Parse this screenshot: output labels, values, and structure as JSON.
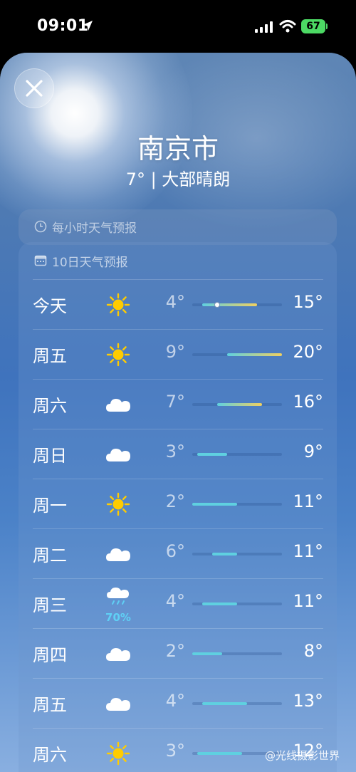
{
  "status_bar": {
    "time": "09:01",
    "battery": "67"
  },
  "header": {
    "city": "南京市",
    "summary": "7° | 大部晴朗"
  },
  "hourly": {
    "label": "每小时天气预报"
  },
  "daily": {
    "label": "10日天气预报",
    "range_min": 2,
    "range_max": 20,
    "days": [
      {
        "day": "今天",
        "icon": "sun-icon",
        "low": "4°",
        "high": "15°",
        "low_v": 4,
        "high_v": 15,
        "current_v": 7,
        "precip": ""
      },
      {
        "day": "周五",
        "icon": "sun-icon",
        "low": "9°",
        "high": "20°",
        "low_v": 9,
        "high_v": 20,
        "precip": ""
      },
      {
        "day": "周六",
        "icon": "cloud-icon",
        "low": "7°",
        "high": "16°",
        "low_v": 7,
        "high_v": 16,
        "precip": ""
      },
      {
        "day": "周日",
        "icon": "cloud-icon",
        "low": "3°",
        "high": "9°",
        "low_v": 3,
        "high_v": 9,
        "precip": ""
      },
      {
        "day": "周一",
        "icon": "sun-icon",
        "low": "2°",
        "high": "11°",
        "low_v": 2,
        "high_v": 11,
        "precip": ""
      },
      {
        "day": "周二",
        "icon": "cloud-icon",
        "low": "6°",
        "high": "11°",
        "low_v": 6,
        "high_v": 11,
        "precip": ""
      },
      {
        "day": "周三",
        "icon": "rain-cloud-icon",
        "low": "4°",
        "high": "11°",
        "low_v": 4,
        "high_v": 11,
        "precip": "70%"
      },
      {
        "day": "周四",
        "icon": "cloud-icon",
        "low": "2°",
        "high": "8°",
        "low_v": 2,
        "high_v": 8,
        "precip": ""
      },
      {
        "day": "周五",
        "icon": "cloud-icon",
        "low": "4°",
        "high": "13°",
        "low_v": 4,
        "high_v": 13,
        "precip": ""
      },
      {
        "day": "周六",
        "icon": "sun-icon",
        "low": "3°",
        "high": "12°",
        "low_v": 3,
        "high_v": 12,
        "precip": ""
      }
    ]
  },
  "watermark": "@光线摄影世界",
  "colors": {
    "precip": "#5fd0f5",
    "sun": "#ffcc00",
    "bar_cool": "#5fd0e0",
    "bar_warm": "#f0d060"
  }
}
